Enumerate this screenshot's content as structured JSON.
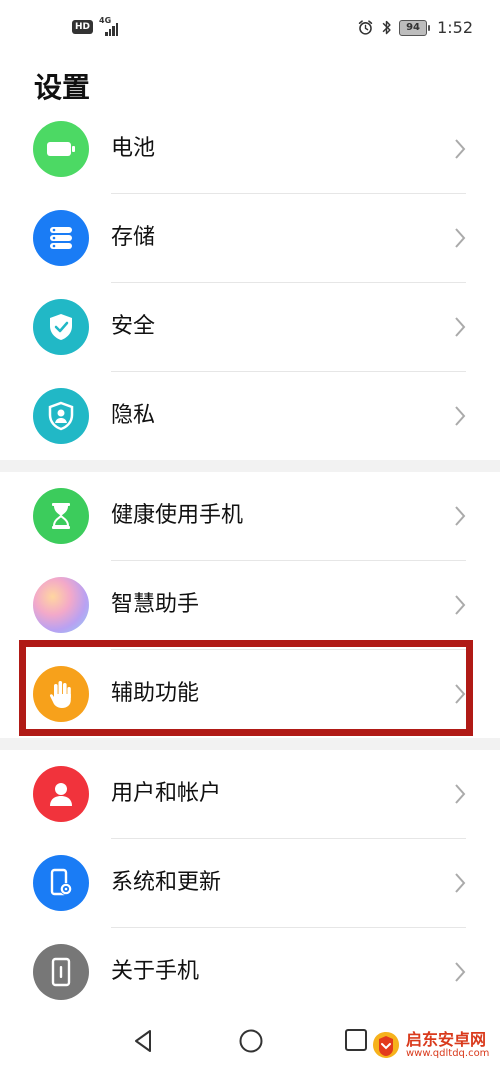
{
  "status_bar": {
    "hd": "HD",
    "network": "4G",
    "battery_level": "94",
    "time": "1:52"
  },
  "title": "设置",
  "groups": [
    {
      "items": [
        {
          "label": "电池",
          "icon": "battery-icon",
          "color": "#4cd964"
        },
        {
          "label": "存储",
          "icon": "storage-icon",
          "color": "#1a7cf5"
        },
        {
          "label": "安全",
          "icon": "shield-icon",
          "color": "#21b8c6"
        },
        {
          "label": "隐私",
          "icon": "privacy-icon",
          "color": "#21b8c6"
        }
      ]
    },
    {
      "items": [
        {
          "label": "健康使用手机",
          "icon": "hourglass-icon",
          "color": "#3ccc5c"
        },
        {
          "label": "智慧助手",
          "icon": "assistant-icon",
          "color": "#c59cf0"
        },
        {
          "label": "辅助功能",
          "icon": "hand-icon",
          "color": "#f7a11b",
          "highlighted": true
        }
      ]
    },
    {
      "items": [
        {
          "label": "用户和帐户",
          "icon": "user-icon",
          "color": "#f1333c"
        },
        {
          "label": "系统和更新",
          "icon": "phone-settings-icon",
          "color": "#1a7cf5"
        },
        {
          "label": "关于手机",
          "icon": "phone-info-icon",
          "color": "#777777"
        }
      ]
    }
  ],
  "nav_bar": {
    "back": "back-icon",
    "home": "home-icon",
    "recents": "recents-icon"
  },
  "watermark": {
    "name": "启东安卓网",
    "url": "www.qdltdq.com"
  }
}
